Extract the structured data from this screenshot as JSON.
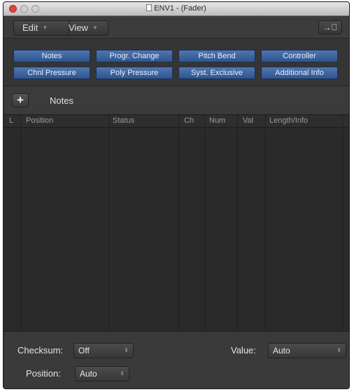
{
  "window": {
    "title": "ENV1 - (Fader)"
  },
  "toolbar": {
    "edit_label": "Edit",
    "view_label": "View",
    "arrow_glyph": "▼",
    "link_glyph": "→⃝"
  },
  "filters": {
    "buttons": [
      "Notes",
      "Progr. Change",
      "Pitch Bend",
      "Controller",
      "Chnl Pressure",
      "Poly Pressure",
      "Syst. Exclusive",
      "Additional Info"
    ]
  },
  "track": {
    "add_label": "+",
    "label": "Notes"
  },
  "list": {
    "columns": [
      "L",
      "Position",
      "Status",
      "Ch",
      "Num",
      "Val",
      "Length/Info"
    ],
    "rows": []
  },
  "bottom": {
    "checksum_label": "Checksum:",
    "checksum_value": "Off",
    "value_label": "Value:",
    "value_value": "Auto",
    "position_label": "Position:",
    "position_value": "Auto",
    "stepper_glyph": "⬍"
  },
  "colors": {
    "filter_active": "#3f66a1",
    "window_bg": "#3a3a3a",
    "list_bg": "#2a2a2a"
  }
}
